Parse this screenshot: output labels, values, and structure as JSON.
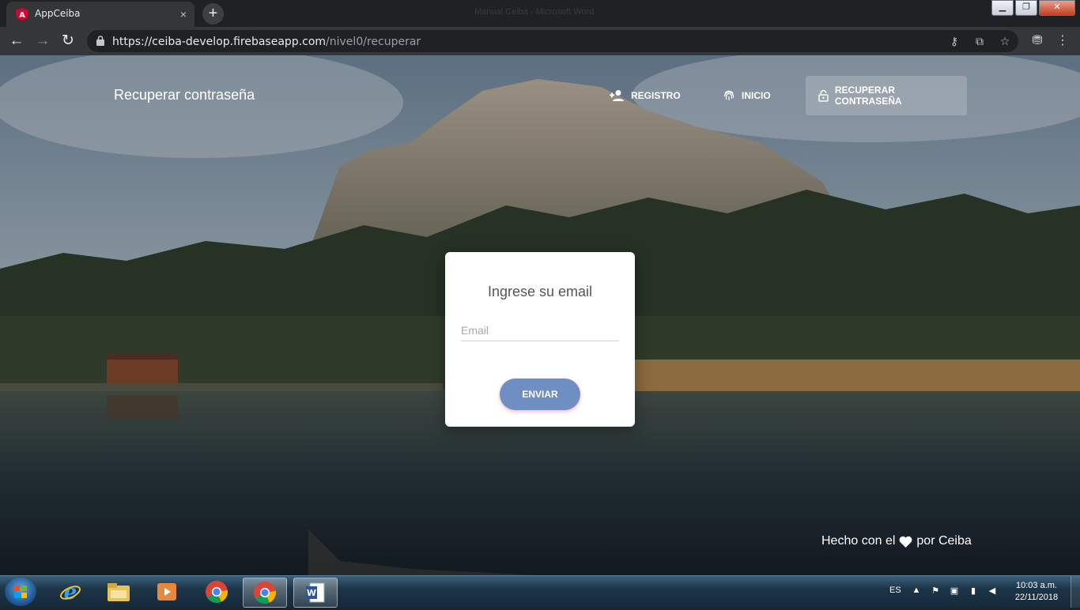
{
  "browser": {
    "tab_title": "AppCeiba",
    "tab_close": "×",
    "new_tab": "+",
    "window_ghost_title": "Manual Ceiba - Microsoft Word",
    "url_host": "https://ceiba-develop.firebaseapp.com",
    "url_path": "/nivel0/recuperar",
    "icons": [
      "lock-icon",
      "key-icon",
      "translate-icon",
      "star-icon",
      "incognito-icon",
      "menu-icon"
    ]
  },
  "page": {
    "site_title": "Recuperar contraseña",
    "nav": {
      "registro": "REGISTRO",
      "inicio": "INICIO",
      "recuperar": "RECUPERAR CONTRASEÑA"
    },
    "card": {
      "title": "Ingrese su email",
      "email_placeholder": "Email",
      "submit": "ENVIAR"
    },
    "footer": {
      "prefix": "Hecho con el",
      "suffix": "por Ceiba"
    },
    "colors": {
      "button": "#6f8ec2",
      "card": "#ffffff"
    }
  },
  "taskbar": {
    "language": "ES",
    "time": "10:03 a.m.",
    "date": "22/11/2018",
    "apps": [
      "internet-explorer",
      "file-explorer",
      "media-player",
      "chrome",
      "chrome-active",
      "word"
    ]
  }
}
